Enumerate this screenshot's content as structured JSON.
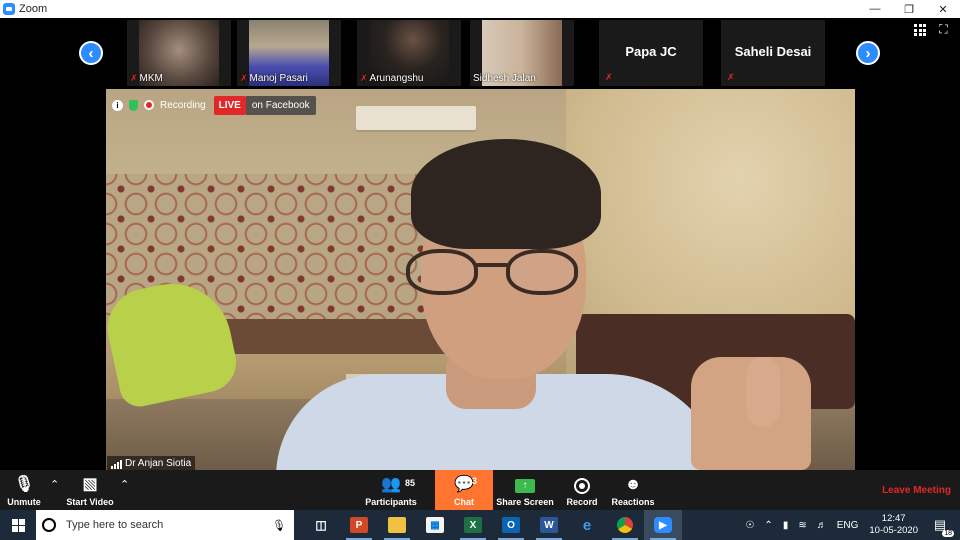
{
  "window": {
    "title": "Zoom",
    "minimize_icon": "minimize-icon",
    "maximize_icon": "restore-icon",
    "close_icon": "close-icon"
  },
  "gallery": {
    "prev_icon": "chevron-left-icon",
    "next_icon": "chevron-right-icon",
    "participants": [
      {
        "name": "MKM",
        "muted": true
      },
      {
        "name": "Manoj Pasari",
        "muted": true
      },
      {
        "name": "Arunangshu",
        "muted": true
      },
      {
        "name": "Sidhesh Jalan",
        "muted": false
      },
      {
        "name": "Papa JC",
        "muted": true,
        "video_off": true
      },
      {
        "name": "Saheli Desai",
        "muted": true,
        "video_off": true
      }
    ]
  },
  "status_bar": {
    "recording": "Recording",
    "live": "LIVE",
    "live_destination": "on Facebook"
  },
  "speaker": {
    "name": "Dr Anjan Siotia"
  },
  "toolbar": {
    "unmute": "Unmute",
    "start_video": "Start Video",
    "participants": "Participants",
    "participants_count": "85",
    "chat": "Chat",
    "chat_count": "3",
    "share_screen": "Share Screen",
    "record": "Record",
    "reactions": "Reactions",
    "leave": "Leave Meeting"
  },
  "taskbar": {
    "search_placeholder": "Type here to search",
    "language": "ENG",
    "time": "12:47",
    "date": "10-05-2020",
    "notification_count": "18"
  },
  "colors": {
    "accent": "#2d8cff",
    "live": "#e02828",
    "chat": "#ff742e",
    "share": "#3dba4e"
  }
}
